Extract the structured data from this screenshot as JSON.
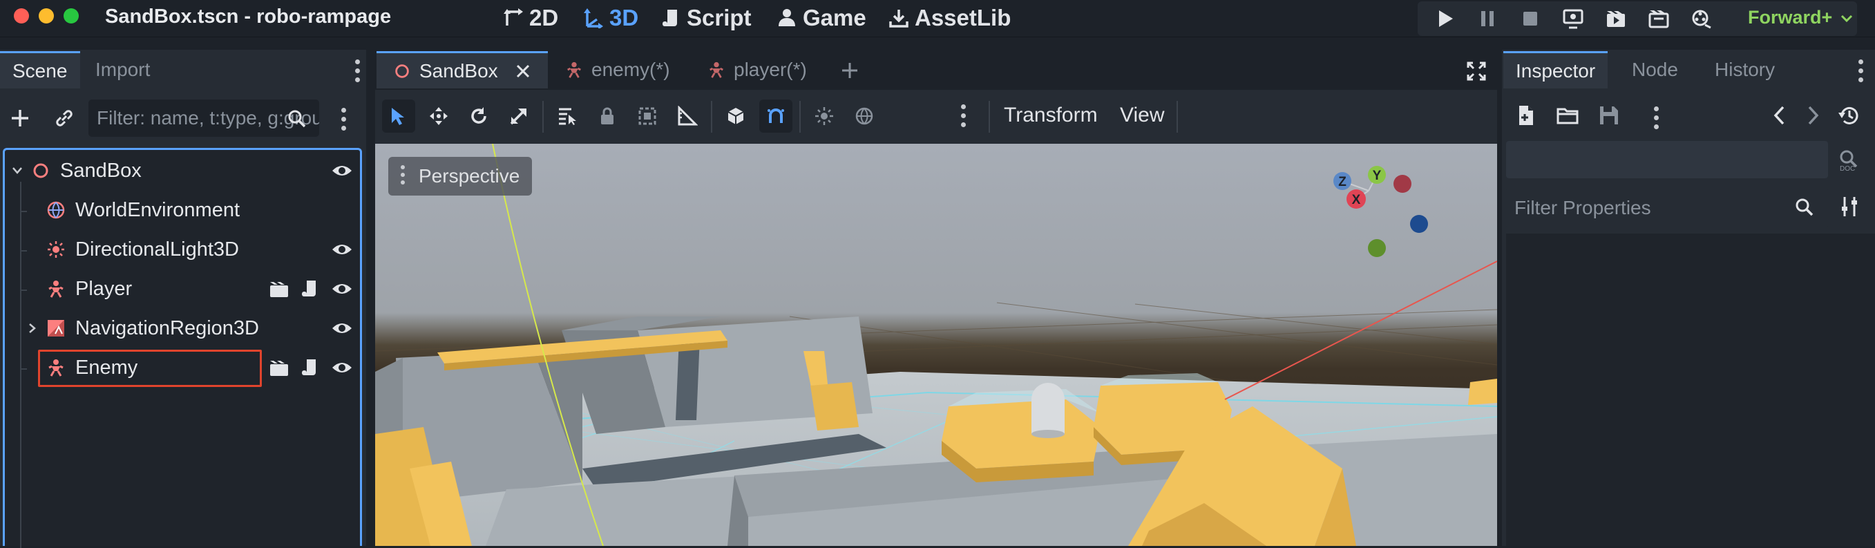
{
  "window": {
    "title": "SandBox.tscn - robo-rampage"
  },
  "modes": [
    {
      "label": "2D",
      "icon": "2d-arrows-icon"
    },
    {
      "label": "3D",
      "icon": "3d-arrows-icon",
      "active": true
    },
    {
      "label": "Script",
      "icon": "script-icon"
    },
    {
      "label": "Game",
      "icon": "game-icon"
    },
    {
      "label": "AssetLib",
      "icon": "download-icon"
    }
  ],
  "run_controls": [
    "play-icon",
    "pause-icon",
    "stop-icon",
    "remote-deploy-icon",
    "play-scene-icon",
    "play-custom-scene-icon",
    "movie-maker-icon"
  ],
  "renderer": "Forward+",
  "left_dock": {
    "tabs": [
      "Scene",
      "Import"
    ],
    "active_tab": "Scene",
    "filter_placeholder": "Filter: name, t:type, g:group",
    "tree": [
      {
        "label": "SandBox",
        "icon": "node3d-icon",
        "expanded": true,
        "visible": true
      },
      {
        "label": "WorldEnvironment",
        "icon": "world-environment-icon"
      },
      {
        "label": "DirectionalLight3D",
        "icon": "directional-light-icon",
        "visible": true
      },
      {
        "label": "Player",
        "icon": "character-body-icon",
        "instanced_scene": true,
        "script": true,
        "visible": true
      },
      {
        "label": "NavigationRegion3D",
        "icon": "navigation-region-icon",
        "collapsed": true,
        "visible": true
      },
      {
        "label": "Enemy",
        "icon": "character-body-icon",
        "instanced_scene": true,
        "script": true,
        "visible": true,
        "highlighted": true
      }
    ]
  },
  "scene_tabs": [
    {
      "label": "SandBox",
      "active": true,
      "icon": "node3d-icon"
    },
    {
      "label": "enemy(*)",
      "icon": "character-body-icon"
    },
    {
      "label": "player(*)",
      "icon": "character-body-icon"
    }
  ],
  "viewport_toolbar": {
    "transform_label": "Transform",
    "view_label": "View"
  },
  "viewport": {
    "perspective_label": "Perspective",
    "gizmo": {
      "x": "X",
      "y": "Y",
      "z": "Z"
    }
  },
  "right_dock": {
    "tabs": [
      "Inspector",
      "Node",
      "History"
    ],
    "active_tab": "Inspector",
    "filter_placeholder": "Filter Properties"
  },
  "colors": {
    "accent": "#5aa2ff",
    "renderer": "#8fd460",
    "highlight": "#e0442d",
    "node3d": "#fc7f7f"
  }
}
